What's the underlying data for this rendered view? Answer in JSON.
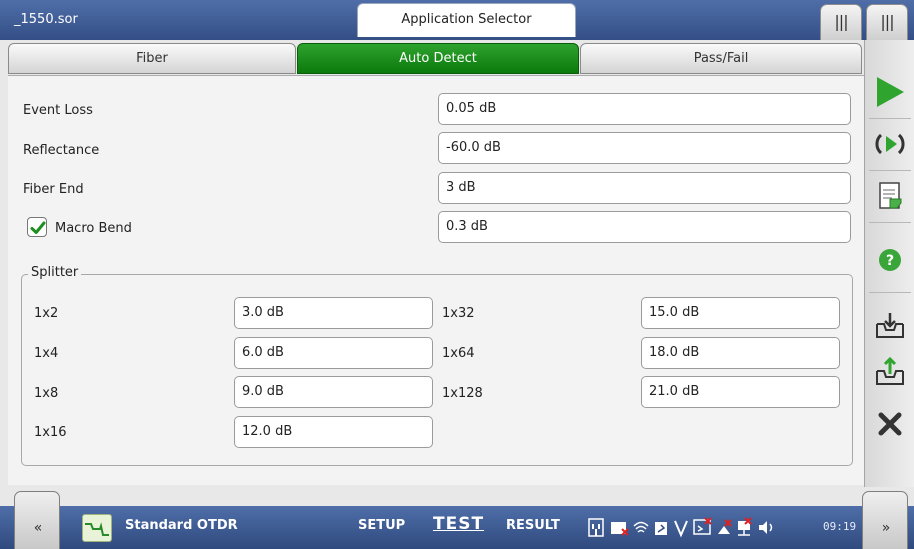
{
  "titlebar": {
    "file_name": "_1550.sor",
    "app_selector": "Application Selector"
  },
  "tabs": [
    {
      "label": "Fiber",
      "active": false
    },
    {
      "label": "Auto Detect",
      "active": true
    },
    {
      "label": "Pass/Fail",
      "active": false
    }
  ],
  "settings": {
    "event_loss": {
      "label": "Event Loss",
      "value": "0.05 dB"
    },
    "reflectance": {
      "label": "Reflectance",
      "value": "-60.0 dB"
    },
    "fiber_end": {
      "label": "Fiber End",
      "value": "3 dB"
    },
    "macro_bend": {
      "label": "Macro Bend",
      "value": "0.3 dB",
      "checked": true
    }
  },
  "splitter": {
    "title": "Splitter",
    "left": [
      {
        "label": "1x2",
        "value": "3.0 dB"
      },
      {
        "label": "1x4",
        "value": "6.0 dB"
      },
      {
        "label": "1x8",
        "value": "9.0 dB"
      },
      {
        "label": "1x16",
        "value": "12.0 dB"
      }
    ],
    "right": [
      {
        "label": "1x32",
        "value": "15.0 dB"
      },
      {
        "label": "1x64",
        "value": "18.0 dB"
      },
      {
        "label": "1x128",
        "value": "21.0 dB"
      }
    ]
  },
  "rightbar": {
    "icons": [
      "play-icon",
      "refresh-icon",
      "report-icon",
      "help-icon",
      "save-icon",
      "export-icon",
      "close-icon"
    ]
  },
  "bottombar": {
    "app_name": "Standard OTDR",
    "setup": "SETUP",
    "test": "TEST",
    "result": "RESULT",
    "time": "09:19",
    "left_tab": "«",
    "right_tab": "»"
  },
  "colors": {
    "title_bar": "#3f5e98",
    "active_tab": "#1a8c1a",
    "play_green": "#2fa52f",
    "close_dark": "#333333",
    "help_green": "#3aa63a"
  }
}
